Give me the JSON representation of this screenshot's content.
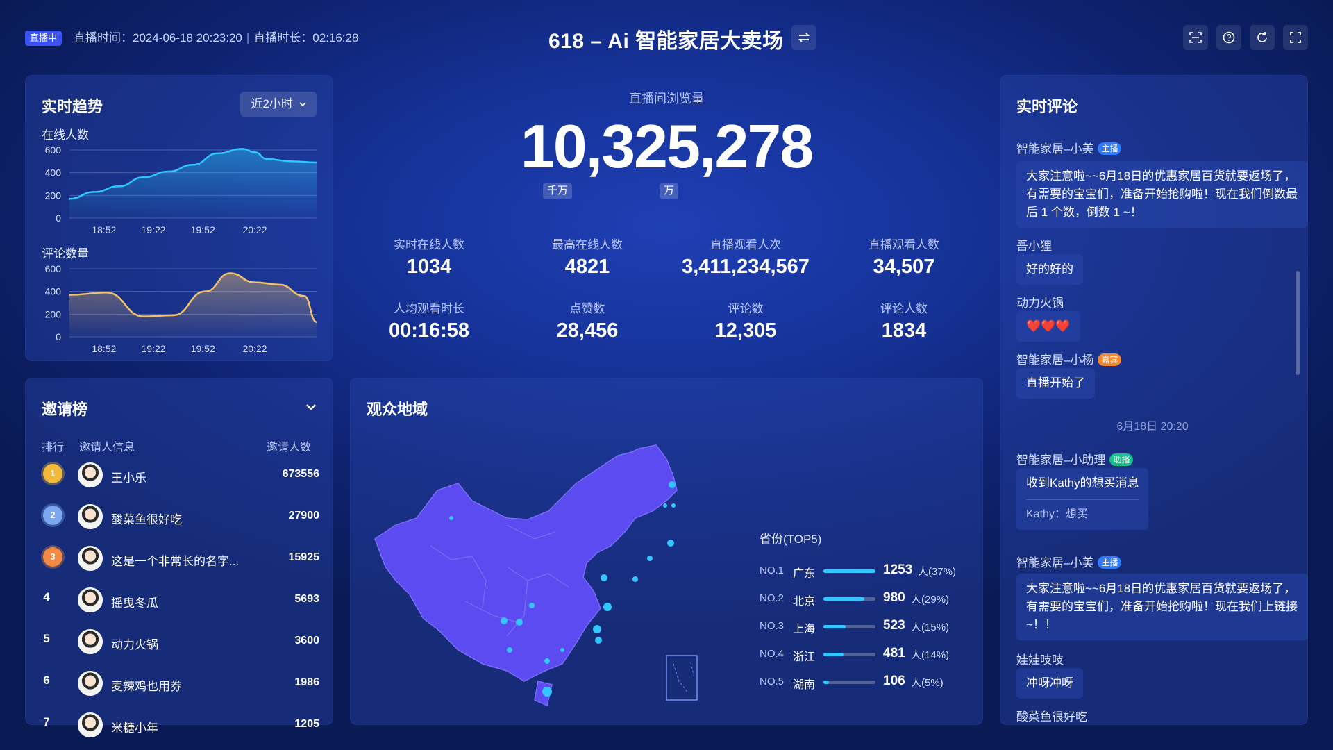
{
  "header": {
    "live_badge": "直播中",
    "live_time_label": "直播时间：",
    "live_time_value": "2024-06-18 20:23:20",
    "duration_label": "直播时长：",
    "duration_value": "02:16:28",
    "title": "618 – Ai 智能家居大卖场"
  },
  "trend": {
    "title": "实时趋势",
    "range_label": "近2小时",
    "online_title": "在线人数",
    "comment_title": "评论数量"
  },
  "overview": {
    "label": "直播间浏览量",
    "value": "10,325,278",
    "unit_thousand_wan": "千万",
    "unit_wan": "万",
    "stats": [
      {
        "label": "实时在线人数",
        "value": "1034"
      },
      {
        "label": "最高在线人数",
        "value": "4821"
      },
      {
        "label": "直播观看人次",
        "value": "3,411,234,567"
      },
      {
        "label": "直播观看人数",
        "value": "34,507"
      },
      {
        "label": "人均观看时长",
        "value": "00:16:58"
      },
      {
        "label": "点赞数",
        "value": "28,456"
      },
      {
        "label": "评论数",
        "value": "12,305"
      },
      {
        "label": "评论人数",
        "value": "1834"
      }
    ]
  },
  "invite": {
    "title": "邀请榜",
    "col_rank": "排行",
    "col_info": "邀请人信息",
    "col_count": "邀请人数",
    "rows": [
      {
        "rank": "1",
        "name": "王小乐",
        "count": "673556"
      },
      {
        "rank": "2",
        "name": "酸菜鱼很好吃",
        "count": "27900"
      },
      {
        "rank": "3",
        "name": "这是一个非常长的名字...",
        "count": "15925"
      },
      {
        "rank": "4",
        "name": "摇曳冬瓜",
        "count": "5693"
      },
      {
        "rank": "5",
        "name": "动力火锅",
        "count": "3600"
      },
      {
        "rank": "6",
        "name": "麦辣鸡也用券",
        "count": "1986"
      },
      {
        "rank": "7",
        "name": "米糖小年",
        "count": "1205"
      }
    ]
  },
  "region": {
    "title": "观众地域",
    "top5_title": "省份(TOP5)",
    "unit": "人",
    "rows": [
      {
        "no": "NO.1",
        "province": "广东",
        "count": "1253",
        "pct": "(37%)",
        "share": 1.0
      },
      {
        "no": "NO.2",
        "province": "北京",
        "count": "980",
        "pct": "(29%)",
        "share": 0.78
      },
      {
        "no": "NO.3",
        "province": "上海",
        "count": "523",
        "pct": "(15%)",
        "share": 0.42
      },
      {
        "no": "NO.4",
        "province": "浙江",
        "count": "481",
        "pct": "(14%)",
        "share": 0.38
      },
      {
        "no": "NO.5",
        "province": "湖南",
        "count": "106",
        "pct": "(5%)",
        "share": 0.1
      }
    ]
  },
  "comments": {
    "title": "实时评论",
    "items": [
      {
        "user": "智能家居–小美",
        "tag": "主播",
        "text": "大家注意啦~~6月18日的优惠家居百货就要返场了，有需要的宝宝们，准备开始抢购啦！现在我们倒数最后 1 个数，倒数 1 ~！"
      },
      {
        "user": "吾小狸",
        "text": "好的好的"
      },
      {
        "user": "动力火锅",
        "text": "❤️❤️❤️"
      },
      {
        "user": "智能家居–小杨",
        "tag": "嘉宾",
        "text": "直播开始了"
      },
      {
        "date": "6月18日 20:20"
      },
      {
        "user": "智能家居–小助理",
        "tag": "助播",
        "text": "收到Kathy的想买消息",
        "subtext": "Kathy：想买"
      },
      {
        "user": "智能家居–小美",
        "tag": "主播",
        "text": "大家注意啦~~6月18日的优惠家居百货就要返场了，有需要的宝宝们，准备开始抢购啦！现在我们上链接~！！"
      },
      {
        "user": "娃娃吱吱",
        "text": "冲呀冲呀"
      },
      {
        "user": "酸菜鱼很好吃"
      }
    ]
  },
  "chart_data": [
    {
      "type": "area",
      "title": "在线人数",
      "x_ticks": [
        "18:52",
        "19:22",
        "19:52",
        "20:22"
      ],
      "ylim": [
        0,
        600
      ],
      "y_ticks": [
        0,
        200,
        400,
        600
      ],
      "x": [
        0,
        0.1,
        0.2,
        0.3,
        0.4,
        0.5,
        0.6,
        0.7,
        0.75,
        0.8,
        0.9,
        1.0
      ],
      "values": [
        170,
        230,
        280,
        360,
        410,
        470,
        570,
        610,
        580,
        520,
        500,
        490
      ],
      "color": "#2ec8ff"
    },
    {
      "type": "area",
      "title": "评论数量",
      "x_ticks": [
        "18:52",
        "19:22",
        "19:52",
        "20:22"
      ],
      "ylim": [
        0,
        600
      ],
      "y_ticks": [
        0,
        200,
        400,
        600
      ],
      "x": [
        0,
        0.15,
        0.3,
        0.42,
        0.55,
        0.65,
        0.75,
        0.85,
        0.95,
        1.0
      ],
      "values": [
        370,
        390,
        180,
        190,
        400,
        560,
        480,
        460,
        360,
        130
      ],
      "color": "#f2c26a"
    }
  ]
}
